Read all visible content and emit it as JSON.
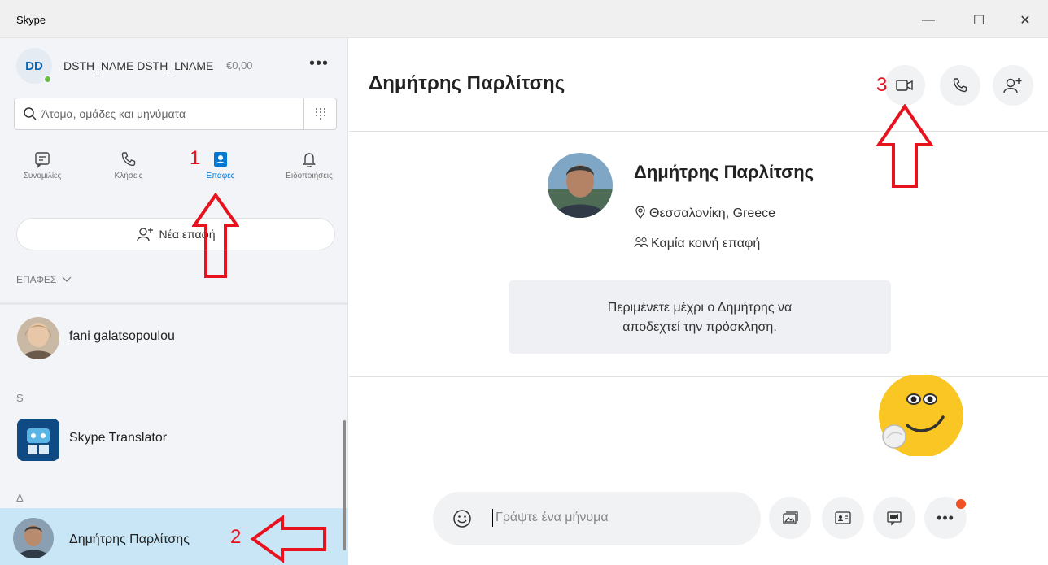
{
  "window": {
    "title": "Skype",
    "minimize": "—",
    "maximize": "☐",
    "close": "✕"
  },
  "profile": {
    "initials": "DD",
    "name": "DSTH_NAME DSTH_LNAME",
    "credit": "€0,00",
    "more": "•••"
  },
  "search": {
    "placeholder": "Άτομα, ομάδες και μηνύματα"
  },
  "nav_tabs": [
    {
      "label": "Συνομιλίες",
      "icon": "chat-icon"
    },
    {
      "label": "Κλήσεις",
      "icon": "phone-icon"
    },
    {
      "label": "Επαφές",
      "icon": "contacts-icon",
      "active": true
    },
    {
      "label": "Ειδοποιήσεις",
      "icon": "bell-icon"
    }
  ],
  "new_contact": {
    "label": "Νέα επαφή"
  },
  "contacts_section": {
    "label": "ΕΠΑΦΕΣ"
  },
  "contacts": [
    {
      "name": "fani galatsopoulou"
    },
    {
      "letter": "S"
    },
    {
      "name": "Skype Translator"
    },
    {
      "letter": "Δ"
    },
    {
      "name": "Δημήτρης Παρλίτσης",
      "selected": true
    }
  ],
  "chat": {
    "title": "Δημήτρης Παρλίτσης",
    "card_name": "Δημήτρης Παρλίτσης",
    "location": "Θεσσαλονίκη, Greece",
    "mutual": "Καμία κοινή επαφή",
    "invite_line1": "Περιμένετε μέχρι ο Δημήτρης να",
    "invite_line2": "αποδεχτεί την πρόσκληση."
  },
  "composer": {
    "placeholder": "Γράψτε ένα μήνυμα"
  },
  "annotations": [
    "1",
    "2",
    "3"
  ],
  "colors": {
    "accent": "#0078d4",
    "annotation": "#e8121e",
    "selected_row": "#c8e6f6",
    "online": "#6bbd45"
  }
}
